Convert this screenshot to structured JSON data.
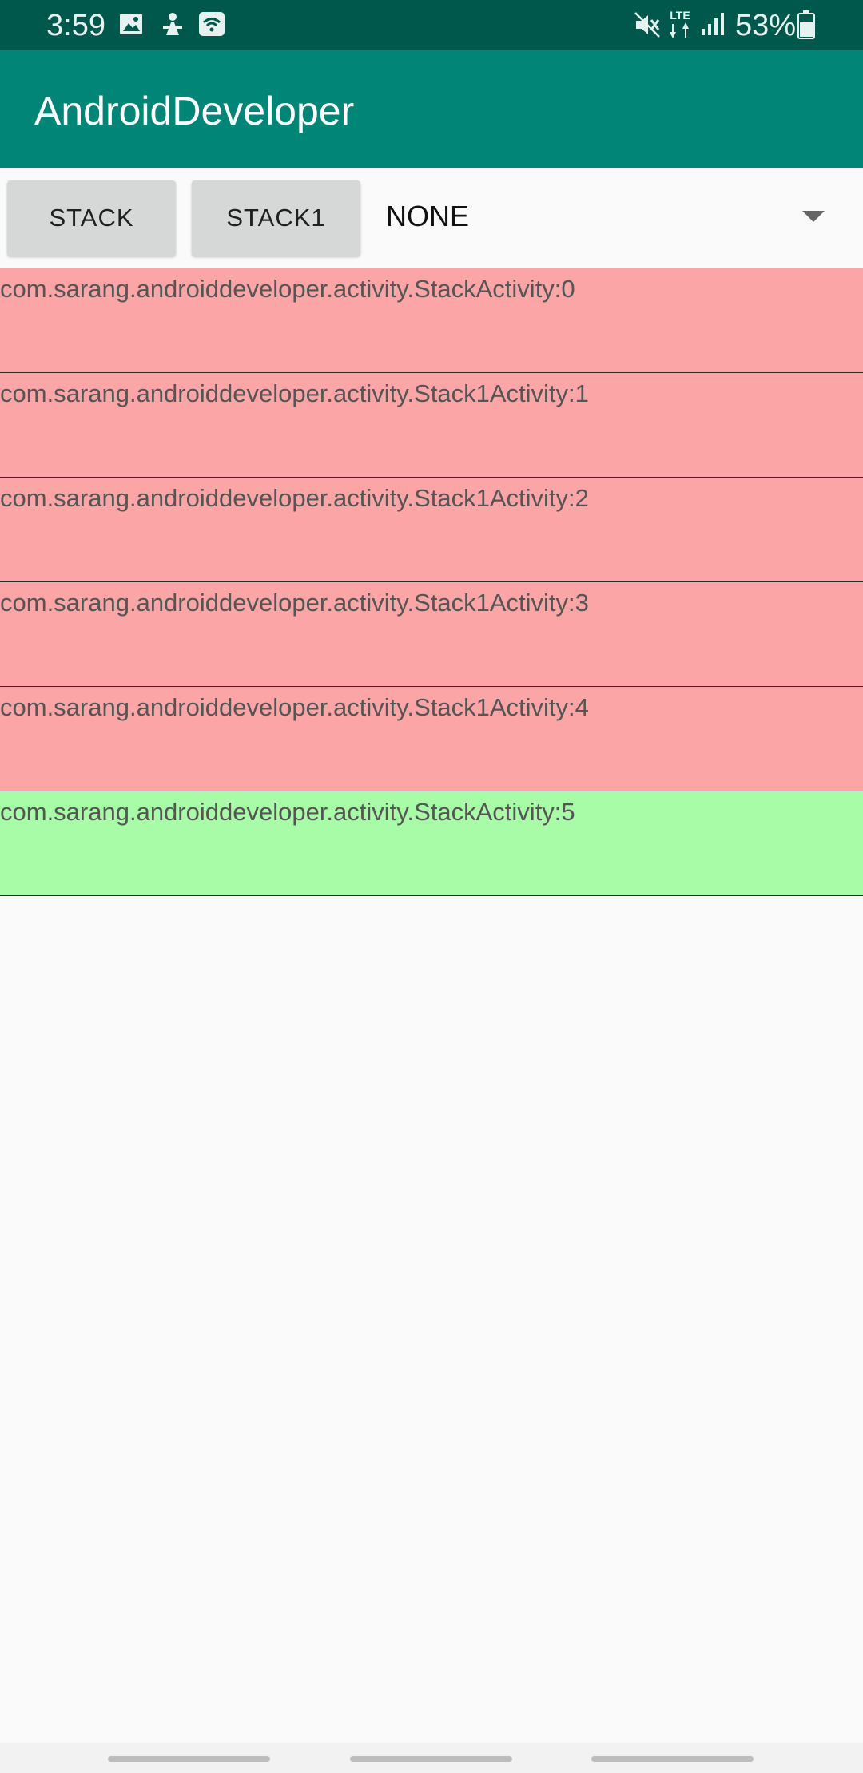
{
  "status_bar": {
    "time": "3:59",
    "battery_percent": "53%",
    "icons": [
      "image-icon",
      "notification-icon",
      "wifi-hotspot-icon",
      "mute-icon",
      "lte-icon",
      "signal-icon",
      "battery-icon"
    ],
    "lte_label": "LTE"
  },
  "app_bar": {
    "title": "AndroidDeveloper"
  },
  "controls": {
    "stack_button": "STACK",
    "stack1_button": "STACK1",
    "spinner_value": "NONE"
  },
  "stack_list": [
    {
      "label": "com.sarang.androiddeveloper.activity.StackActivity:0",
      "color": "#fca5a6"
    },
    {
      "label": "com.sarang.androiddeveloper.activity.Stack1Activity:1",
      "color": "#fca5a6"
    },
    {
      "label": "com.sarang.androiddeveloper.activity.Stack1Activity:2",
      "color": "#fca5a6"
    },
    {
      "label": "com.sarang.androiddeveloper.activity.Stack1Activity:3",
      "color": "#fca5a6"
    },
    {
      "label": "com.sarang.androiddeveloper.activity.Stack1Activity:4",
      "color": "#fca5a6"
    },
    {
      "label": "com.sarang.androiddeveloper.activity.StackActivity:5",
      "color": "#a8fca7"
    }
  ],
  "colors": {
    "status_bar": "#00574b",
    "app_bar": "#008577",
    "background": "#fafafa"
  }
}
